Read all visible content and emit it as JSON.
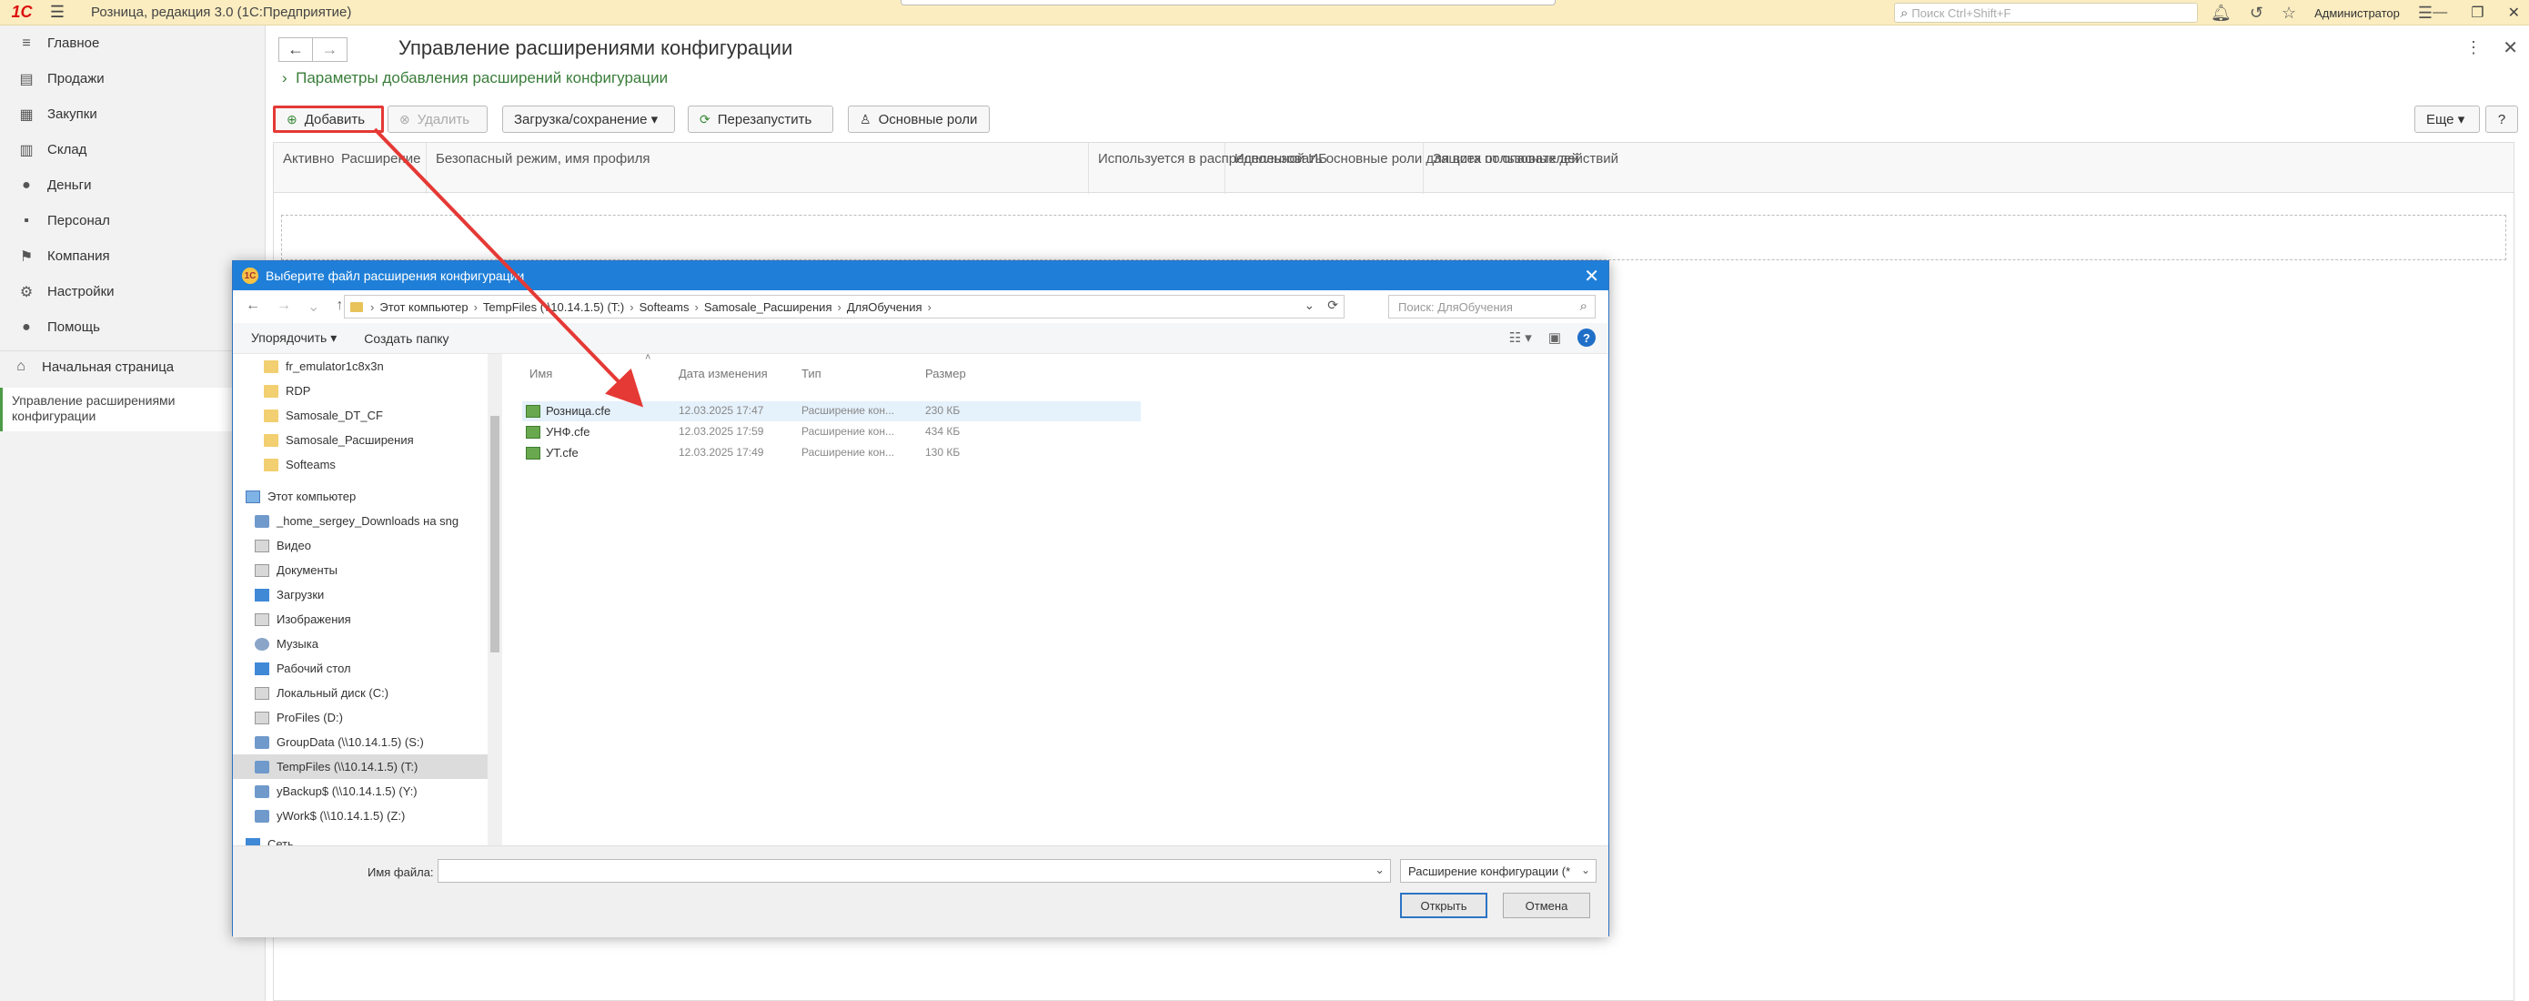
{
  "topbar": {
    "logo": "1С",
    "app_title": "Розница, редакция 3.0  (1С:Предприятие)",
    "search_placeholder": "Поиск Ctrl+Shift+F",
    "user": "Администратор"
  },
  "sidebar": {
    "items": [
      {
        "label": "Главное",
        "icon": "≡"
      },
      {
        "label": "Продажи",
        "icon": "▤"
      },
      {
        "label": "Закупки",
        "icon": "▦"
      },
      {
        "label": "Склад",
        "icon": "▥"
      },
      {
        "label": "Деньги",
        "icon": "●"
      },
      {
        "label": "Персонал",
        "icon": "▪"
      },
      {
        "label": "Компания",
        "icon": "⚑"
      },
      {
        "label": "Настройки",
        "icon": "⚙"
      },
      {
        "label": "Помощь",
        "icon": "●"
      }
    ],
    "home_label": "Начальная страница",
    "open_form_label": "Управление расширениями конфигурации"
  },
  "form": {
    "title": "Управление расширениями конфигурации",
    "params_link": "Параметры добавления расширений конфигурации",
    "toolbar": {
      "add": "Добавить",
      "delete": "Удалить",
      "load_save": "Загрузка/сохранение",
      "restart": "Перезапустить",
      "main_roles": "Основные роли",
      "more": "Еще",
      "help": "?"
    },
    "columns": [
      "Активно",
      "Расширение",
      "Безопасный режим, имя профиля",
      "Используется в распределенной ИБ",
      "Использовать основные роли для всех пользователей",
      "Защита от опасных действий"
    ]
  },
  "dialog": {
    "title": "Выберите файл расширения конфигурации",
    "breadcrumb": [
      "Этот компьютер",
      "TempFiles (\\\\10.14.1.5) (T:)",
      "Softeams",
      "Samosale_Расширения",
      "ДляОбучения"
    ],
    "search_placeholder": "Поиск: ДляОбучения",
    "organize": "Упорядочить ▾",
    "new_folder": "Создать папку",
    "tree": [
      {
        "label": "fr_emulator1c8x3n",
        "icon": "folder"
      },
      {
        "label": "RDP",
        "icon": "folder"
      },
      {
        "label": "Samosale_DT_CF",
        "icon": "folder"
      },
      {
        "label": "Samosale_Расширения",
        "icon": "folder"
      },
      {
        "label": "Softeams",
        "icon": "folder"
      },
      {
        "label": "Этот компьютер",
        "icon": "pc"
      },
      {
        "label": "_home_sergey_Downloads на sng",
        "icon": "net"
      },
      {
        "label": "Видео",
        "icon": "drive"
      },
      {
        "label": "Документы",
        "icon": "drive"
      },
      {
        "label": "Загрузки",
        "icon": "blue"
      },
      {
        "label": "Изображения",
        "icon": "drive"
      },
      {
        "label": "Музыка",
        "icon": "music"
      },
      {
        "label": "Рабочий стол",
        "icon": "blue"
      },
      {
        "label": "Локальный диск (C:)",
        "icon": "drive"
      },
      {
        "label": "ProFiles (D:)",
        "icon": "drive"
      },
      {
        "label": "GroupData (\\\\10.14.1.5) (S:)",
        "icon": "net"
      },
      {
        "label": "TempFiles (\\\\10.14.1.5) (T:)",
        "icon": "net"
      },
      {
        "label": "yBackup$ (\\\\10.14.1.5) (Y:)",
        "icon": "net"
      },
      {
        "label": "yWork$ (\\\\10.14.1.5) (Z:)",
        "icon": "net"
      },
      {
        "label": "Сеть",
        "icon": "blue"
      }
    ],
    "headers": {
      "name": "Имя",
      "date": "Дата изменения",
      "type": "Тип",
      "size": "Размер"
    },
    "files": [
      {
        "name": "Розница.cfe",
        "date": "12.03.2025 17:47",
        "type": "Расширение кон...",
        "size": "230 КБ"
      },
      {
        "name": "УНФ.cfe",
        "date": "12.03.2025 17:59",
        "type": "Расширение кон...",
        "size": "434 КБ"
      },
      {
        "name": "УТ.cfe",
        "date": "12.03.2025 17:49",
        "type": "Расширение кон...",
        "size": "130 КБ"
      }
    ],
    "file_name_label": "Имя файла:",
    "file_type": "Расширение конфигурации (*",
    "open": "Открыть",
    "cancel": "Отмена"
  }
}
